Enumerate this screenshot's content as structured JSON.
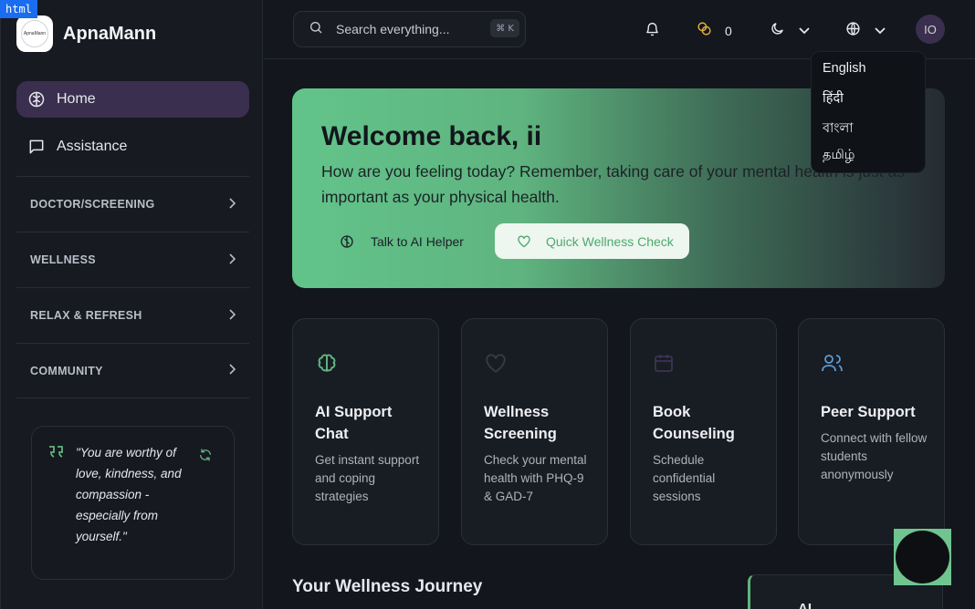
{
  "devtools": {
    "tag": "html"
  },
  "brand": {
    "name": "ApnaMann",
    "logo_text": "ApnaMann"
  },
  "sidebar": {
    "nav": [
      {
        "label": "Home",
        "icon": "brain-icon",
        "active": true
      },
      {
        "label": "Assistance",
        "icon": "chat-icon",
        "active": false
      }
    ],
    "sections": [
      {
        "label": "DOCTOR/SCREENING"
      },
      {
        "label": "WELLNESS"
      },
      {
        "label": "RELAX & REFRESH"
      },
      {
        "label": "COMMUNITY"
      }
    ],
    "quote": {
      "text": "\"You are worthy of love, kindness, and compassion - especially from yourself.\""
    }
  },
  "topbar": {
    "search": {
      "placeholder": "Search everything...",
      "shortcut": "⌘ K"
    },
    "coins": "0",
    "avatar_initials": "IO"
  },
  "language_menu": {
    "options": [
      "English",
      "हिंदी",
      "বাংলা",
      "தமிழ்"
    ]
  },
  "hero": {
    "title": "Welcome back, ii",
    "subtitle": "How are you feeling today? Remember, taking care of your mental health is just as important as your physical health.",
    "ai_button": "Talk to AI Helper",
    "check_button": "Quick Wellness Check"
  },
  "cards": [
    {
      "title": "AI Support Chat",
      "description": "Get instant support and coping strategies",
      "icon": "brain-icon"
    },
    {
      "title": "Wellness Screening",
      "description": "Check your mental health with PHQ-9 & GAD-7",
      "icon": "heart-icon"
    },
    {
      "title": "Book Counseling",
      "description": "Schedule confidential sessions",
      "icon": "calendar-icon"
    },
    {
      "title": "Peer Support",
      "description": "Connect with fellow students anonymously",
      "icon": "users-icon"
    }
  ],
  "journey": {
    "title": "Your Wellness Journey"
  },
  "mini_panel": {
    "label": "AI"
  },
  "colors": {
    "accent_green": "#5fb47f",
    "active_nav": "#3a2f4e",
    "background": "#13161c"
  }
}
